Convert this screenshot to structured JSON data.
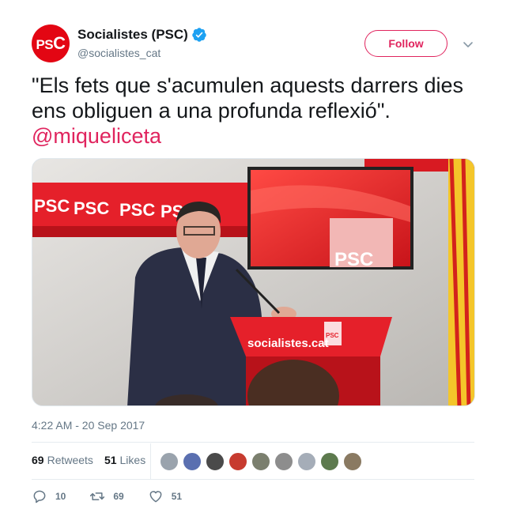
{
  "author": {
    "display_name": "Socialistes (PSC)",
    "handle": "@socialistes_cat",
    "avatar_text_a": "PS",
    "avatar_text_b": "C",
    "verified": true
  },
  "follow_label": "Follow",
  "tweet": {
    "text": "\"Els fets que s'acumulen aquests darrers dies ens obliguen a una profunda reflexió\".",
    "mention": "@miqueliceta"
  },
  "media": {
    "wall_logo": "PSC",
    "screen_logo": "PSC",
    "podium_text": "socialistes.cat",
    "podium_badge": "PSC"
  },
  "timestamp": "4:22 AM - 20 Sep 2017",
  "stats": {
    "retweets_count": "69",
    "retweets_label": "Retweets",
    "likes_count": "51",
    "likes_label": "Likes"
  },
  "liker_colors": [
    "#9aa3ad",
    "#5a6fb0",
    "#4a4a4a",
    "#c73b2f",
    "#7b7f6e",
    "#8d8d8d",
    "#a5adb8",
    "#5d7a4e",
    "#8a7a62"
  ],
  "actions": {
    "reply_count": "10",
    "retweet_count": "69",
    "like_count": "51"
  },
  "colors": {
    "brand_red": "#e30613",
    "link": "#e0245e",
    "verified_blue": "#1da1f2"
  }
}
